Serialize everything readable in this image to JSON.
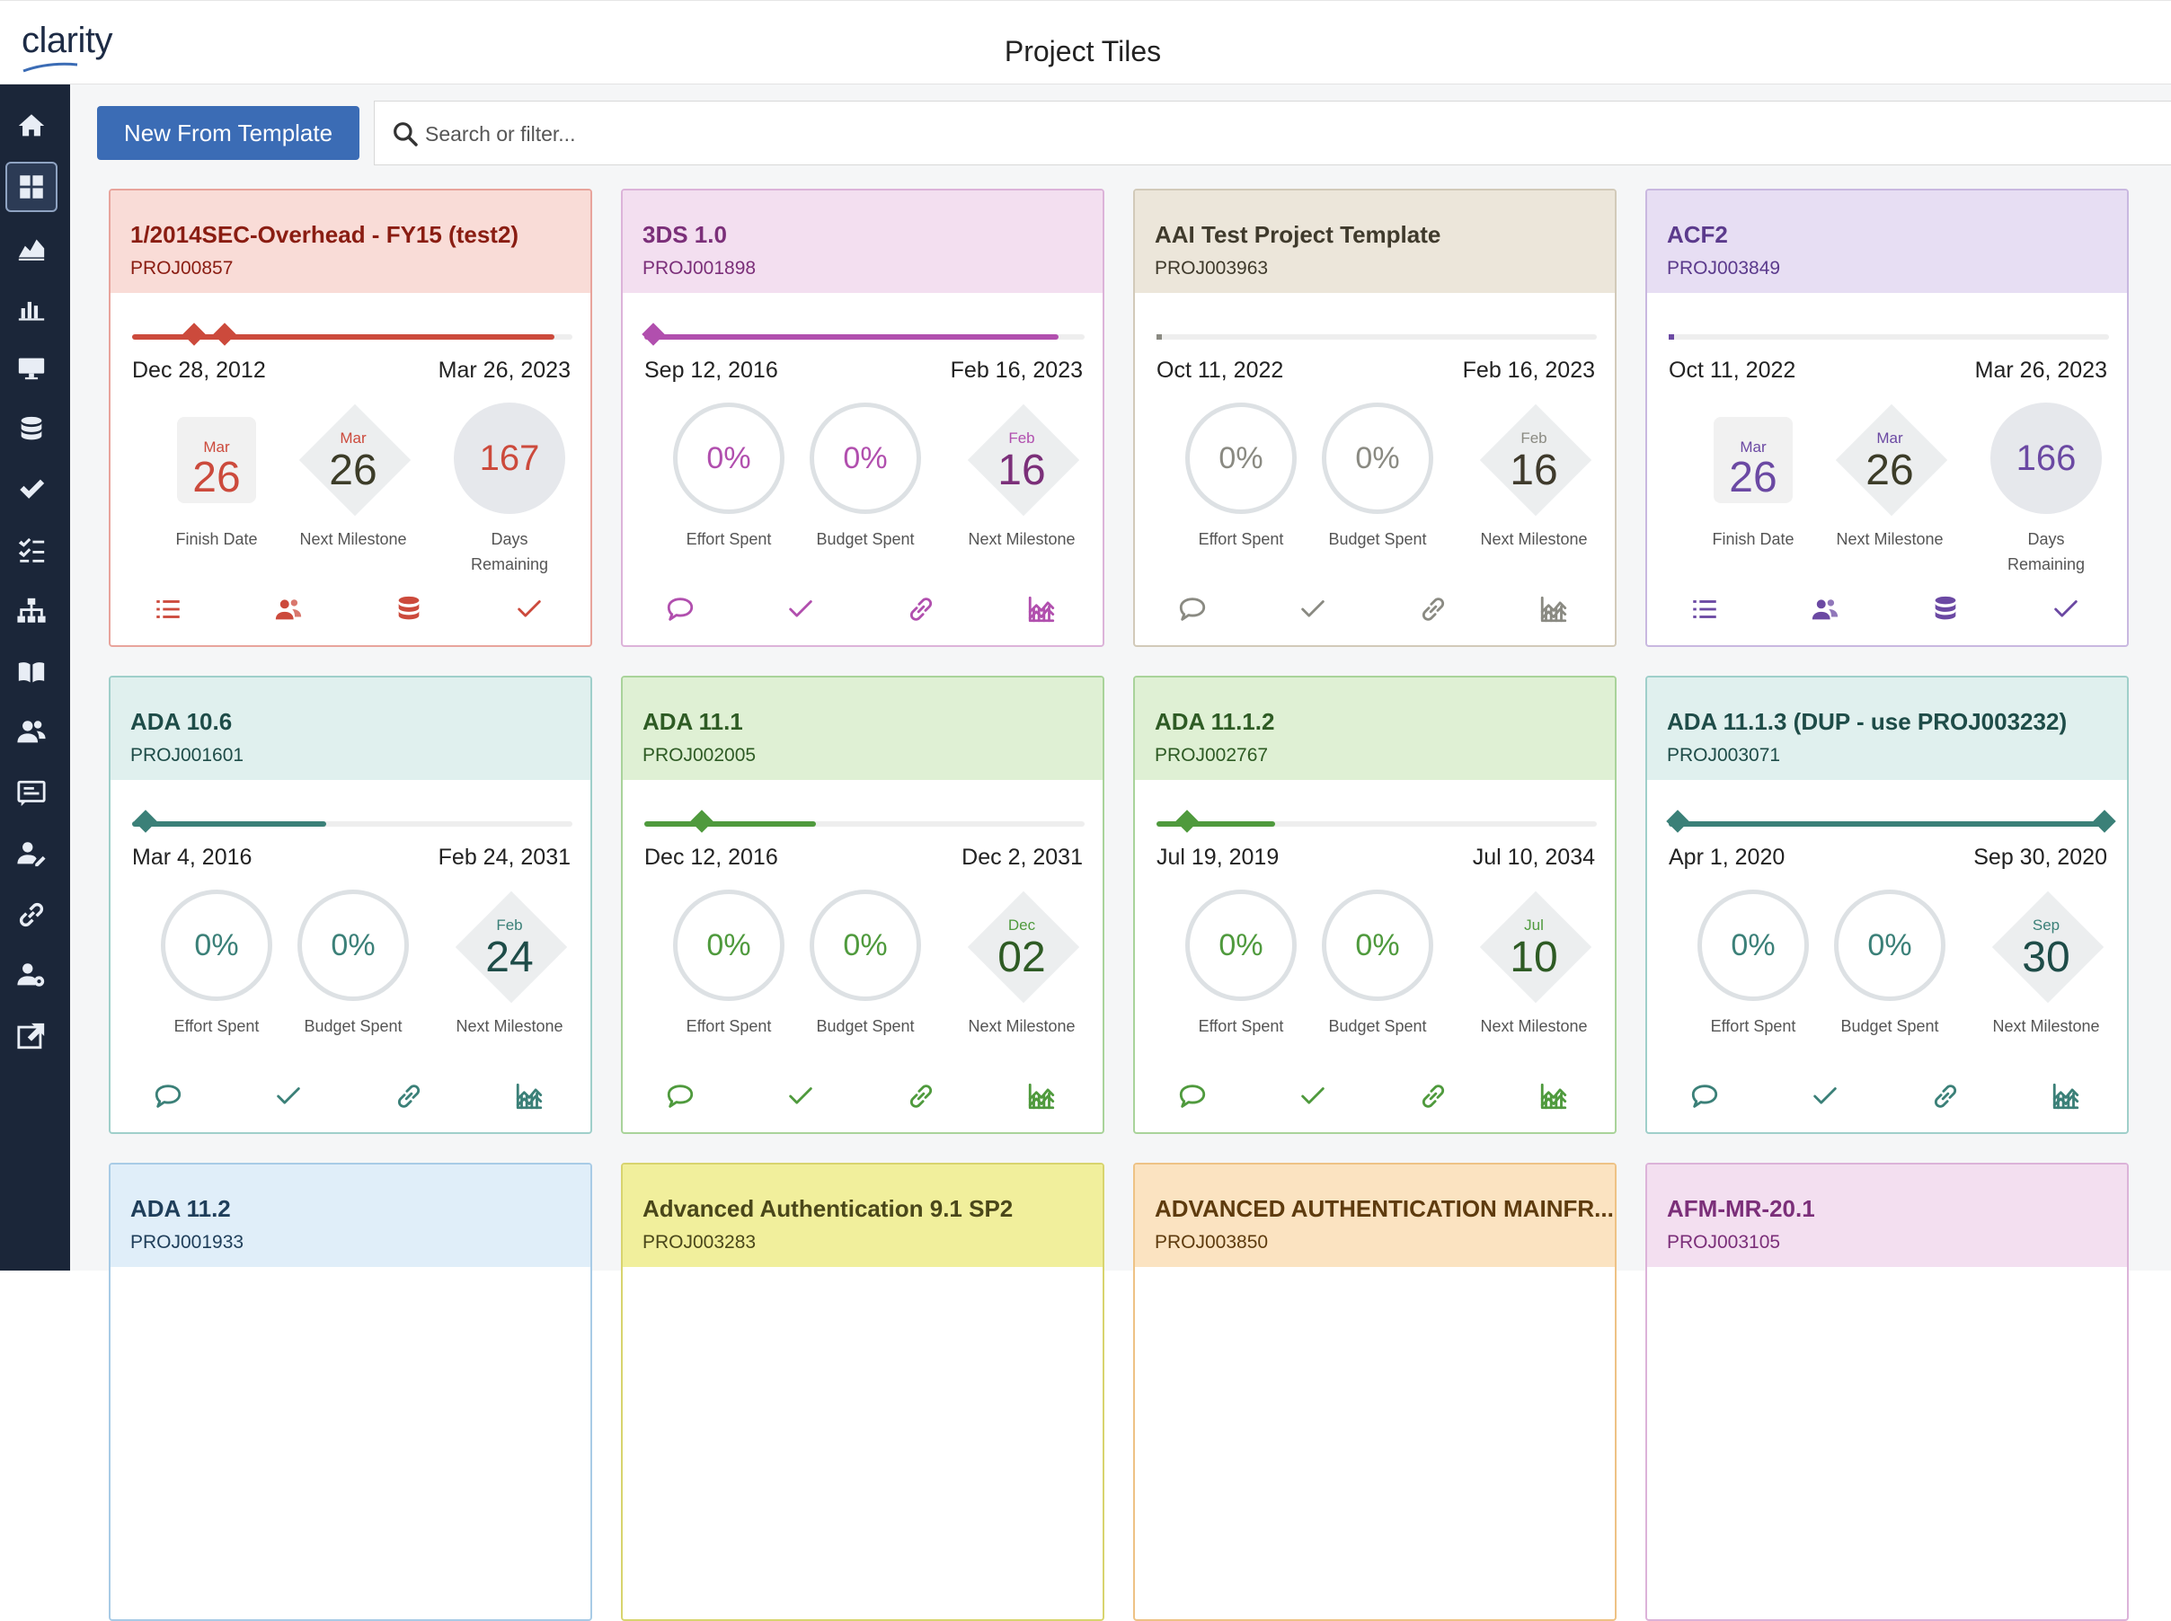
{
  "app": {
    "logo": "clarity",
    "title": "Project Tiles"
  },
  "toolbar": {
    "new_button": "New From Template",
    "search_placeholder": "Search or filter..."
  },
  "sidebar": {
    "items": [
      "home",
      "tiles",
      "trends",
      "reports",
      "monitor",
      "data",
      "tasks",
      "checklist",
      "hierarchy",
      "book",
      "people",
      "roadmap",
      "resources",
      "links",
      "settings",
      "export"
    ]
  },
  "labels": {
    "finish_date": "Finish Date",
    "next_milestone": "Next Milestone",
    "days_remaining": "Days\nRemaining",
    "effort_spent": "Effort Spent",
    "budget_spent": "Budget Spent"
  },
  "tiles": [
    {
      "name": "1/2014SEC-Overhead - FY15 (test2)",
      "code": "PROJ00857",
      "start": "Dec 28, 2012",
      "end": "Mar 26, 2023",
      "m1": {
        "mon": "Mar",
        "day": "26"
      },
      "m2": {
        "mon": "Mar",
        "day": "26"
      },
      "m3": "167",
      "theme": "red"
    },
    {
      "name": "3DS 1.0",
      "code": "PROJ001898",
      "start": "Sep 12, 2016",
      "end": "Feb 16, 2023",
      "m1": "0%",
      "m2": "0%",
      "m3": {
        "mon": "Feb",
        "day": "16"
      },
      "theme": "pink"
    },
    {
      "name": "AAI Test Project Template",
      "code": "PROJ003963",
      "start": "Oct 11, 2022",
      "end": "Feb 16, 2023",
      "m1": "0%",
      "m2": "0%",
      "m3": {
        "mon": "Feb",
        "day": "16"
      },
      "theme": "tan"
    },
    {
      "name": "ACF2",
      "code": "PROJ003849",
      "start": "Oct 11, 2022",
      "end": "Mar 26, 2023",
      "m1": {
        "mon": "Mar",
        "day": "26"
      },
      "m2": {
        "mon": "Mar",
        "day": "26"
      },
      "m3": "166",
      "theme": "purple"
    },
    {
      "name": "ADA 10.6",
      "code": "PROJ001601",
      "start": "Mar 4, 2016",
      "end": "Feb 24, 2031",
      "m1": "0%",
      "m2": "0%",
      "m3": {
        "mon": "Feb",
        "day": "24"
      },
      "theme": "teal"
    },
    {
      "name": "ADA 11.1",
      "code": "PROJ002005",
      "start": "Dec 12, 2016",
      "end": "Dec 2, 2031",
      "m1": "0%",
      "m2": "0%",
      "m3": {
        "mon": "Dec",
        "day": "02"
      },
      "theme": "green"
    },
    {
      "name": "ADA 11.1.2",
      "code": "PROJ002767",
      "start": "Jul 19, 2019",
      "end": "Jul 10, 2034",
      "m1": "0%",
      "m2": "0%",
      "m3": {
        "mon": "Jul",
        "day": "10"
      },
      "theme": "green"
    },
    {
      "name": "ADA 11.1.3 (DUP - use PROJ003232)",
      "code": "PROJ003071",
      "start": "Apr 1, 2020",
      "end": "Sep 30, 2020",
      "m1": "0%",
      "m2": "0%",
      "m3": {
        "mon": "Sep",
        "day": "30"
      },
      "theme": "teal"
    },
    {
      "name": "ADA 11.2",
      "code": "PROJ001933",
      "theme": "blue"
    },
    {
      "name": "Advanced Authentication 9.1 SP2",
      "code": "PROJ003283",
      "theme": "yellow"
    },
    {
      "name": "ADVANCED AUTHENTICATION MAINFR...",
      "code": "PROJ003850",
      "theme": "orange"
    },
    {
      "name": "AFM-MR-20.1",
      "code": "PROJ003105",
      "theme": "pink"
    }
  ],
  "colors": {
    "red": {
      "border": "#e8a49c",
      "head": "#f9dcd7",
      "text": "#8a1d12",
      "accent": "#cc4a3c"
    },
    "pink": {
      "border": "#dcb3d9",
      "head": "#f3dff0",
      "text": "#7b2f79",
      "accent": "#b14fae"
    },
    "tan": {
      "border": "#d2cab9",
      "head": "#ece6da",
      "text": "#3f3a2c",
      "accent": "#8a8a82"
    },
    "purple": {
      "border": "#c9b8e0",
      "head": "#e7def3",
      "text": "#5b3a8c",
      "accent": "#6b49a3"
    },
    "teal": {
      "border": "#9fcfca",
      "head": "#e0f0ee",
      "text": "#1e4c48",
      "accent": "#3b8078"
    },
    "green": {
      "border": "#a9d39a",
      "head": "#dff0d4",
      "text": "#2e5b24",
      "accent": "#4f9a3d"
    },
    "blue": {
      "border": "#a8cbe6",
      "head": "#e0eef9",
      "text": "#1f3e5a",
      "accent": "#3b78b0"
    },
    "yellow": {
      "border": "#d8d46e",
      "head": "#f1ef9c",
      "text": "#4a471a",
      "accent": "#8a8530"
    },
    "orange": {
      "border": "#eec285",
      "head": "#fbe3c1",
      "text": "#5e3b0e",
      "accent": "#c7822b"
    }
  }
}
